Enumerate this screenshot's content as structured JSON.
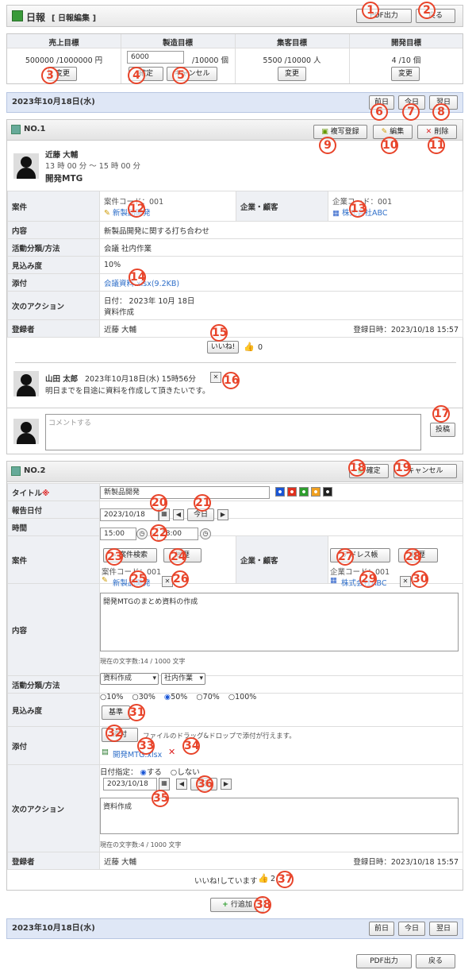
{
  "header": {
    "title": "日報",
    "subtitle": "[ 日報編集 ]",
    "pdf": "PDF出力",
    "back": "戻る"
  },
  "targets": {
    "cols": [
      "売上目標",
      "製造目標",
      "集客目標",
      "開発目標"
    ],
    "sales": "500000 /1000000 円",
    "mfg_input": "6000",
    "mfg_total": "/10000 個",
    "customer": "5500 /10000 人",
    "dev": "4 /10 個",
    "change": "変更",
    "confirm": "確定",
    "cancel": "キャンセル"
  },
  "date_bar": {
    "date": "2023年10月18日(水)",
    "prev": "前日",
    "today": "今日",
    "next": "翌日"
  },
  "entry1": {
    "no": "NO.1",
    "copy": "複写登録",
    "edit": "編集",
    "delete": "削除",
    "person": "近藤 大輔",
    "time": "13 時 00 分 ～ 15 時 00 分",
    "subject": "開発MTG",
    "case_label": "案件",
    "case_code": "案件コード：001",
    "case_name": "新製品開発",
    "company_label": "企業・顧客",
    "company_code": "企業コード：001",
    "company_name": "株式会社ABC",
    "content_label": "内容",
    "content": "新製品開発に関する打ち合わせ",
    "activity_label": "活動分類/方法",
    "activity": "会議 社内作業",
    "prob_label": "見込み度",
    "prob": "10%",
    "attach_label": "添付",
    "attach": "会議資料.xlsx(9.2KB)",
    "next_label": "次のアクション",
    "next_date": "日付： 2023年 10月 18日",
    "next_text": "資料作成",
    "reg_label": "登録者",
    "reg_name": "近藤 大輔",
    "reg_date": "登録日時：2023/10/18 15:57",
    "like": "いいね!",
    "like_count": "0",
    "comment_name": "山田 太郎",
    "comment_time": "2023年10月18日(水) 15時56分",
    "comment_text": "明日までを目途に資料を作成して頂きたいです。",
    "comment_placeholder": "コメントする",
    "post": "投稿"
  },
  "entry2": {
    "no": "NO.2",
    "confirm": "確定",
    "cancel": "キャンセル",
    "title_label": "タイトル",
    "required": "※",
    "title_value": "新製品開発",
    "date_label": "報告日付",
    "date_value": "2023/10/18",
    "today": "今日",
    "time_label": "時間",
    "time_start": "15:00",
    "time_end": "18:00",
    "case_label": "案件",
    "case_search": "案件検索",
    "history": "履歴",
    "case_code": "案件コード：001",
    "case_name": "新製品開発",
    "company_label": "企業・顧客",
    "address_book": "アドレス帳",
    "company_code": "企業コード：001",
    "company_name": "株式会社ABC",
    "content_label": "内容",
    "content_value": "開発MTGのまとめ資料の作成",
    "content_count": "現在の文字数:14 / 1000 文字",
    "activity_label": "活動分類/方法",
    "activity_sel1": "資料作成",
    "activity_sel2": "社内作業",
    "prob_label": "見込み度",
    "prob_opts": [
      "10%",
      "30%",
      "50%",
      "70%",
      "100%"
    ],
    "prob_selected": "50%",
    "standard": "基準",
    "attach_label": "添付",
    "attach_btn": "添付",
    "attach_hint": "ファイルのドラッグ&ドロップで添付が行えます。",
    "attach_file": "開発MTG.xlsx",
    "next_label": "次のアクション",
    "date_spec": "日付指定：",
    "yes": "する",
    "no_opt": "しない",
    "next_date": "2023/10/18",
    "next_text": "資料作成",
    "next_count": "現在の文字数:4 / 1000 文字",
    "reg_label": "登録者",
    "reg_name": "近藤 大輔",
    "reg_date": "登録日時：2023/10/18 15:57",
    "liked": "いいね!しています",
    "like_count": "2"
  },
  "add_row": "行追加",
  "footer_bar": {
    "date": "2023年10月18日(水)",
    "prev": "前日",
    "today": "今日",
    "next": "翌日"
  },
  "footer": {
    "pdf": "PDF出力",
    "back": "戻る"
  },
  "annotations": [
    "1",
    "2",
    "3",
    "4",
    "5",
    "6",
    "7",
    "8",
    "9",
    "10",
    "11",
    "12",
    "13",
    "14",
    "15",
    "16",
    "17",
    "18",
    "19",
    "20",
    "21",
    "22",
    "23",
    "24",
    "25",
    "26",
    "27",
    "28",
    "29",
    "30",
    "31",
    "32",
    "33",
    "34",
    "35",
    "36",
    "37",
    "38"
  ],
  "colors": {
    "bar": "#dfe7f6",
    "annotation": "#e8442a",
    "link": "#2f6fc9",
    "colorset": [
      "#1a56d6",
      "#e0301e",
      "#2e9e2e",
      "#f0a020",
      "#222222"
    ]
  }
}
